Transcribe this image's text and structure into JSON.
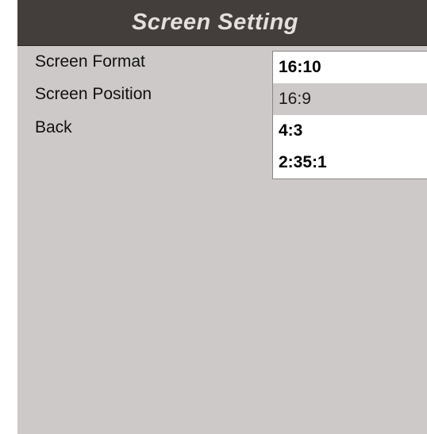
{
  "window": {
    "title": "Screen Setting"
  },
  "menu": {
    "items": [
      {
        "label": "Screen Format"
      },
      {
        "label": "Screen Position"
      },
      {
        "label": "Back"
      }
    ]
  },
  "format_dropdown": {
    "options": [
      {
        "label": "16:10",
        "highlighted": false
      },
      {
        "label": "16:9",
        "highlighted": true
      },
      {
        "label": "4:3",
        "highlighted": false
      },
      {
        "label": "2:35:1",
        "highlighted": false
      }
    ]
  },
  "colors": {
    "title_bar": "#433d3c",
    "panel": "#cdc9c8",
    "title_text": "#e2dfde",
    "dropdown_bg": "#ffffff",
    "highlight": "#cdc9c8"
  }
}
